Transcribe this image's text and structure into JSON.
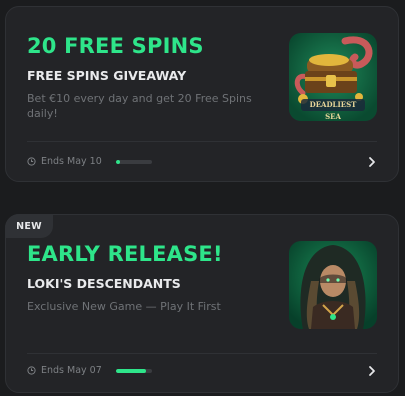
{
  "promos": [
    {
      "title": "20 FREE SPINS",
      "subtitle": "FREE SPINS GIVEAWAY",
      "description": "Bet €10 every day and get 20 Free Spins daily!",
      "ends": "Ends May 10",
      "progress": 0.12,
      "thumbnail_label": "DEADLIEST SEA"
    },
    {
      "badge": "NEW",
      "title": "EARLY RELEASE!",
      "subtitle": "LOKI'S DESCENDANTS",
      "description": "Exclusive New Game — Play It First",
      "ends": "Ends May 07",
      "progress": 0.82
    }
  ],
  "icons": {
    "clock": "clock-icon",
    "chevron": "chevron-right-icon"
  },
  "colors": {
    "accent": "#2ee58a",
    "card": "#232427",
    "background": "#1b1c1e"
  }
}
